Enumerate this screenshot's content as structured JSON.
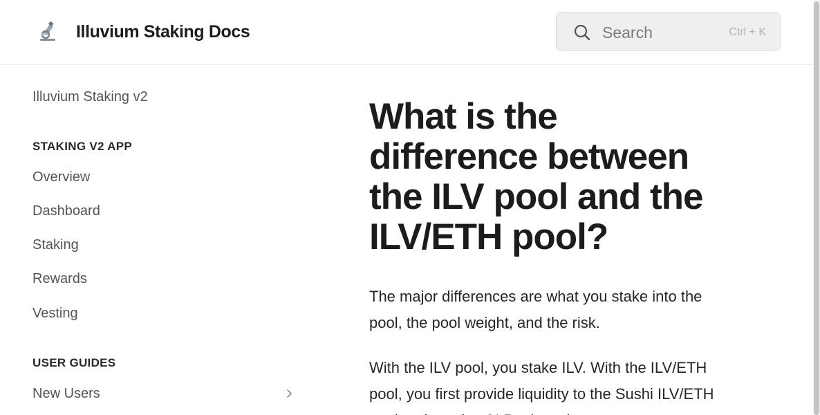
{
  "header": {
    "title": "Illuvium Staking Docs",
    "logo_icon": "microscope-icon"
  },
  "search": {
    "placeholder": "Search",
    "shortcut": "Ctrl + K",
    "icon": "search-icon"
  },
  "sidebar": {
    "top_link": "Illuvium Staking v2",
    "sections": [
      {
        "heading": "STAKING V2 APP",
        "items": [
          "Overview",
          "Dashboard",
          "Staking",
          "Rewards",
          "Vesting"
        ]
      },
      {
        "heading": "USER GUIDES",
        "items": [
          "New Users"
        ]
      }
    ]
  },
  "main": {
    "title": "What is the difference between the ILV pool and the ILV/ETH pool?",
    "paragraphs": [
      "The major differences are what you stake into the pool, the pool weight, and the risk.",
      "With the ILV pool, you stake ILV. With the ILV/ETH pool, you first provide liquidity to the Sushi ILV/ETH pool and receive SLP tokens in"
    ]
  },
  "colors": {
    "text_primary": "#1c1c1c",
    "text_secondary": "#555555",
    "search_bg": "#efefef"
  }
}
